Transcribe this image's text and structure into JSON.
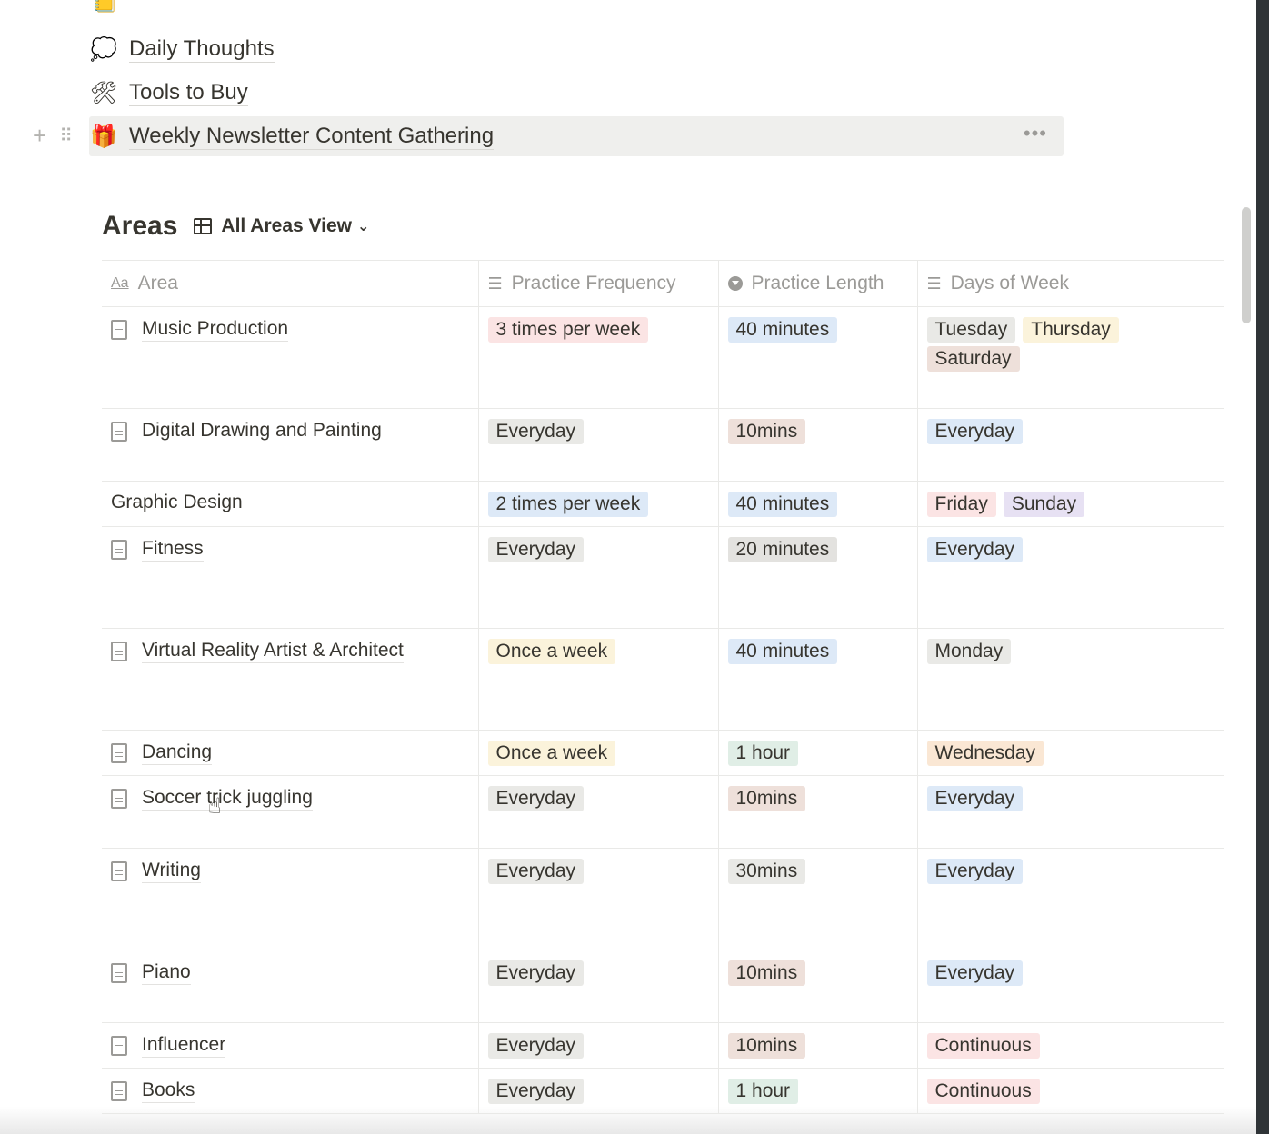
{
  "pages": [
    {
      "icon": "speech-bubble-icon",
      "glyph": "💭",
      "label": "Daily Thoughts"
    },
    {
      "icon": "hammer-wrench-icon",
      "glyph": "🛠",
      "label": "Tools to Buy"
    },
    {
      "icon": "gift-icon",
      "glyph": "🎁",
      "label": "Weekly Newsletter Content Gathering",
      "active": true
    }
  ],
  "row_controls": {
    "add": "+",
    "drag": "⠿",
    "more": "•••"
  },
  "areas": {
    "title": "Areas",
    "view_label": "All Areas View",
    "columns": [
      {
        "icon": "Aa",
        "label": "Area"
      },
      {
        "icon": "☰",
        "label": "Practice Frequency"
      },
      {
        "icon": "select-icon",
        "label": "Practice Length"
      },
      {
        "icon": "☰",
        "label": "Days of Week"
      }
    ],
    "rows": [
      {
        "name": "Music Production",
        "doc": true,
        "frequency": "3 times per week",
        "length": "40 minutes",
        "days": [
          "Tuesday",
          "Thursday",
          "Saturday"
        ]
      },
      {
        "name": "Digital Drawing and Painting",
        "doc": true,
        "frequency": "Everyday",
        "length": "10mins",
        "days": [
          "Everyday"
        ]
      },
      {
        "name": "Graphic Design",
        "doc": false,
        "frequency": "2 times per week",
        "length": "40 minutes",
        "days": [
          "Friday",
          "Sunday"
        ]
      },
      {
        "name": "Fitness",
        "doc": true,
        "frequency": "Everyday",
        "length": "20 minutes",
        "days": [
          "Everyday"
        ]
      },
      {
        "name": "Virtual Reality Artist & Architect",
        "doc": true,
        "frequency": "Once a week",
        "length": "40 minutes",
        "days": [
          "Monday"
        ]
      },
      {
        "name": "Dancing",
        "doc": true,
        "frequency": "Once a week",
        "length": "1 hour",
        "days": [
          "Wednesday"
        ]
      },
      {
        "name": "Soccer trick juggling",
        "doc": true,
        "frequency": "Everyday",
        "length": "10mins",
        "days": [
          "Everyday"
        ]
      },
      {
        "name": "Writing",
        "doc": true,
        "frequency": "Everyday",
        "length": "30mins",
        "days": [
          "Everyday"
        ]
      },
      {
        "name": "Piano",
        "doc": true,
        "frequency": "Everyday",
        "length": "10mins",
        "days": [
          "Everyday"
        ]
      },
      {
        "name": "Influencer",
        "doc": true,
        "frequency": "Everyday",
        "length": "10mins",
        "days": [
          "Continuous"
        ]
      },
      {
        "name": "Books",
        "doc": true,
        "frequency": "Everyday",
        "length": "1 hour",
        "days": [
          "Continuous"
        ]
      }
    ]
  },
  "tag_colors": {
    "3 times per week": "red",
    "2 times per week": "blue",
    "Everyday": "gray",
    "Once a week": "yellow",
    "40 minutes": "blue",
    "10mins": "brown",
    "20 minutes": "default",
    "1 hour": "green",
    "30mins": "gray",
    "Tuesday": "gray",
    "Thursday": "yellow",
    "Saturday": "brown",
    "Friday": "red",
    "Sunday": "purple",
    "Monday": "gray",
    "Wednesday": "orange",
    "Continuous": "red",
    "Everyday_days": "blue"
  }
}
